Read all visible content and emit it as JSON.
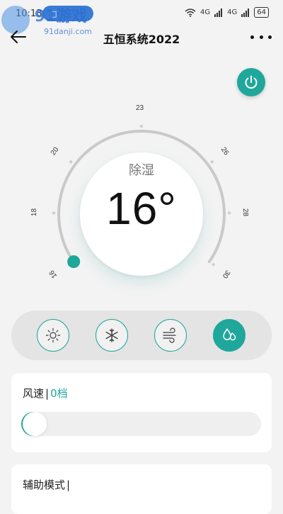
{
  "status_bar": {
    "time": "10:13",
    "pill_text": "□",
    "signal_1": "4G",
    "signal_2": "4G",
    "battery": "64"
  },
  "watermark": {
    "text": "91游戏",
    "url": "91danji.com"
  },
  "header": {
    "title": "五恒系统2022"
  },
  "dial": {
    "mode": "除湿",
    "temperature": "16°",
    "current_value": 16,
    "min": 16,
    "max": 30,
    "tick_labels": [
      "16",
      "18",
      "20",
      "23",
      "26",
      "28",
      "30"
    ]
  },
  "modes": [
    {
      "name": "heat",
      "icon": "sun-icon",
      "active": false
    },
    {
      "name": "cool",
      "icon": "snowflake-icon",
      "active": false
    },
    {
      "name": "fan",
      "icon": "wind-icon",
      "active": false
    },
    {
      "name": "dehumidify",
      "icon": "water-drops-icon",
      "active": true
    }
  ],
  "fan_speed": {
    "label": "风速",
    "separator": "|",
    "value": "0档",
    "level": 0
  },
  "assist_mode": {
    "label": "辅助模式",
    "separator": "|"
  },
  "colors": {
    "accent": "#1fa79b",
    "background": "#f3f3f3"
  }
}
